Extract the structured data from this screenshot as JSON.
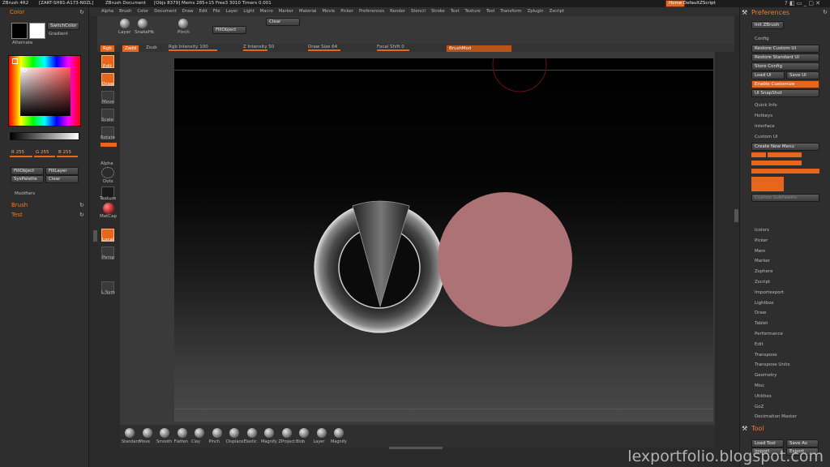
{
  "titlebar": {
    "app": "ZBrush 4R2",
    "doc": "[ZART-SH81-A173-N0ZL]",
    "name": "ZBrush Document",
    "stats": "[Objs 8379] Mems 285+15 Free3 3010 Timers 0.001",
    "home": "Home",
    "script": "DefaultZScript"
  },
  "menus": [
    "Alpha",
    "Brush",
    "Color",
    "Document",
    "Draw",
    "Edit",
    "File",
    "Layer",
    "Light",
    "Macro",
    "Marker",
    "Material",
    "Movie",
    "Picker",
    "Preferences",
    "Render",
    "Stencil",
    "Stroke",
    "Text",
    "Texture",
    "Tool",
    "Transform",
    "Zplugin",
    "Zscript"
  ],
  "topshelf": {
    "layer": "Layer",
    "snake": "SnakeHk",
    "pinch": "Pinch",
    "clear": "Clear",
    "fill": "FillObject"
  },
  "sliders": {
    "rgb": "Rgb",
    "zadd": "Zadd",
    "zsub": "Zsub",
    "rgb_intensity": "Rgb Intensity 100",
    "z_intensity": "Z Intensity 50",
    "draw_size": "Draw Size 64",
    "focal_shift": "Focal Shift 0",
    "brush_mod": "BrushMod"
  },
  "colorpanel": {
    "title": "Color",
    "switch": "SwitchColor",
    "gradient": "Gradient",
    "alternate": "Alternate",
    "r": "R 255",
    "g": "G 255",
    "b": "B 255",
    "fillobject": "FillObject",
    "filllayer": "FillLayer",
    "syspalette": "SysPalette",
    "clear": "Clear",
    "modifiers": "Modifiers",
    "brush": "Brush",
    "test": "Test"
  },
  "leftshelf": {
    "edit": "Edit",
    "draw": "Draw",
    "move": "Move",
    "scale": "Scale",
    "rotate": "Rotate",
    "alpha": "Alpha",
    "dots": "Dots",
    "texture": "Texture",
    "matcap": "MatCap",
    "local": "Local",
    "persp": "Persp",
    "lsym": "L.Sym"
  },
  "brushes": [
    "Standard",
    "Move",
    "Smooth",
    "Flatten",
    "Clay",
    "Pinch",
    "Displace",
    "Elastic",
    "Magnify",
    "ZProject",
    "Blob",
    "Layer",
    "Magnify"
  ],
  "prefs": {
    "title": "Preferences",
    "init": "Init ZBrush",
    "config": "Config",
    "restore_custom": "Restore Custom UI",
    "restore_standard": "Restore Standard UI",
    "store_config": "Store Config",
    "load_ui": "Load Ui",
    "save_ui": "Save Ui",
    "enable_customize": "Enable Customize",
    "ui_snapshot": "UI SnapShot",
    "quickinfo": "Quick Info",
    "hotkeys": "Hotkeys",
    "interface": "Interface",
    "custom_ui": "Custom UI",
    "create_menu": "Create New Menu",
    "custom_subpalette": "Custom SubPalette",
    "list": [
      "Icolors",
      "Picker",
      "Mem",
      "Marker",
      "Zsphere",
      "Zscript",
      "Importexport",
      "Lightbox",
      "Draw",
      "Tablet",
      "Performance",
      "Edit",
      "Transpose",
      "Transpose Units",
      "Geometry",
      "Misc",
      "Utilities",
      "GoZ",
      "Decimation Master"
    ],
    "tool": "Tool",
    "load_tool": "Load Tool",
    "save_as": "Save As",
    "import": "Import",
    "export": "Export"
  },
  "watermark": "lexportfolio.blogspot.com",
  "colors": {
    "accent": "#e8651c",
    "sphere": "#ad7276",
    "torus": "#cfcfcf"
  }
}
